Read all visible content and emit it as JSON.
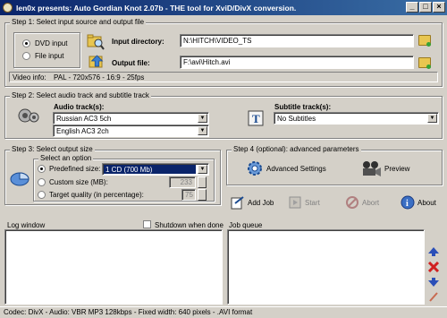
{
  "window": {
    "title": "len0x presents: Auto Gordian Knot 2.07b - THE tool for XviD/DivX conversion."
  },
  "step1": {
    "legend": "Step 1: Select input source and output file",
    "dvd_input": "DVD input",
    "file_input": "File input",
    "input_dir_label": "Input directory:",
    "input_dir_value": "N:\\HITCH\\VIDEO_TS",
    "output_file_label": "Output file:",
    "output_file_value": "F:\\avi\\Hitch.avi",
    "video_info_label": "Video info:",
    "video_info_value": "PAL - 720x576 - 16:9 - 25fps"
  },
  "step2": {
    "legend": "Step 2: Select audio track and subtitle track",
    "audio_label": "Audio track(s):",
    "audio_track1": "Russian AC3 5ch",
    "audio_track2": "English AC3 2ch",
    "subtitle_label": "Subtitle track(s):",
    "subtitle_value": "No Subtitles"
  },
  "step3": {
    "legend": "Step 3: Select output size",
    "option_legend": "Select an option",
    "predefined_label": "Predefined size:",
    "predefined_value": "1 CD (700 Mb)",
    "custom_label": "Custom size (MB):",
    "custom_value": "233",
    "quality_label": "Target quality (in percentage):",
    "quality_value": "75"
  },
  "step4": {
    "legend": "Step 4 (optional): advanced parameters",
    "advanced_label": "Advanced Settings",
    "preview_label": "Preview"
  },
  "toolbar": {
    "add_job": "Add Job",
    "start": "Start",
    "abort": "Abort",
    "about": "About"
  },
  "log": {
    "label": "Log window",
    "shutdown_label": "Shutdown when done"
  },
  "jobs": {
    "label": "Job queue"
  },
  "status": {
    "text": "Codec: DivX - Audio: VBR MP3 128kbps - Fixed width: 640 pixels - .AVI format"
  },
  "colors": {
    "title_start": "#0a246a",
    "title_end": "#3a6ea5",
    "face": "#d4d0c8",
    "selection": "#0a246a"
  }
}
